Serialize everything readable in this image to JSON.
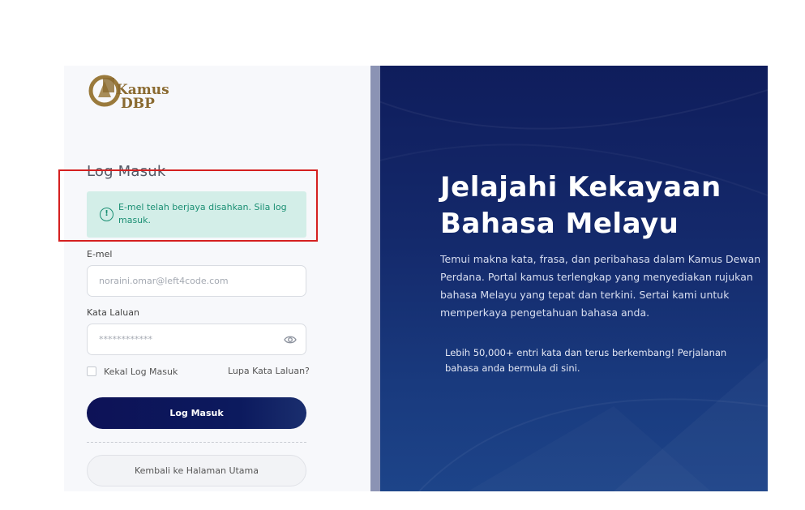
{
  "brand": {
    "logo_line1": "Kamus",
    "logo_line2": "DBP"
  },
  "login": {
    "title": "Log Masuk",
    "alert_text": "E-mel telah berjaya disahkan. Sila log masuk.",
    "email_label": "E-mel",
    "email_placeholder": "noraini.omar@left4code.com",
    "password_label": "Kata Laluan",
    "password_placeholder": "************",
    "remember_label": "Kekal Log Masuk",
    "forgot_label": "Lupa Kata Laluan?",
    "submit_label": "Log Masuk",
    "home_label": "Kembali ke Halaman Utama"
  },
  "hero": {
    "title": "Jelajahi Kekayaan Bahasa Melayu",
    "description": "Temui makna kata, frasa, dan peribahasa dalam Kamus Dewan Perdana. Portal kamus terlengkap yang menyediakan rujukan bahasa Melayu yang tepat dan terkini. Sertai kami untuk memperkaya pengetahuan bahasa anda.",
    "note": "Lebih 50,000+ entri kata dan terus berkembang! Perjalanan bahasa anda bermula di sini."
  },
  "colors": {
    "alert_bg": "#d3eee8",
    "alert_text": "#1a8f73",
    "primary_button": "#0d1257",
    "hero_bg": "#14296b",
    "highlight_border": "#d52020",
    "logo_gold": "#9a7a3c"
  },
  "icons": {
    "alert": "info-circle-icon",
    "password_toggle": "eye-icon"
  }
}
